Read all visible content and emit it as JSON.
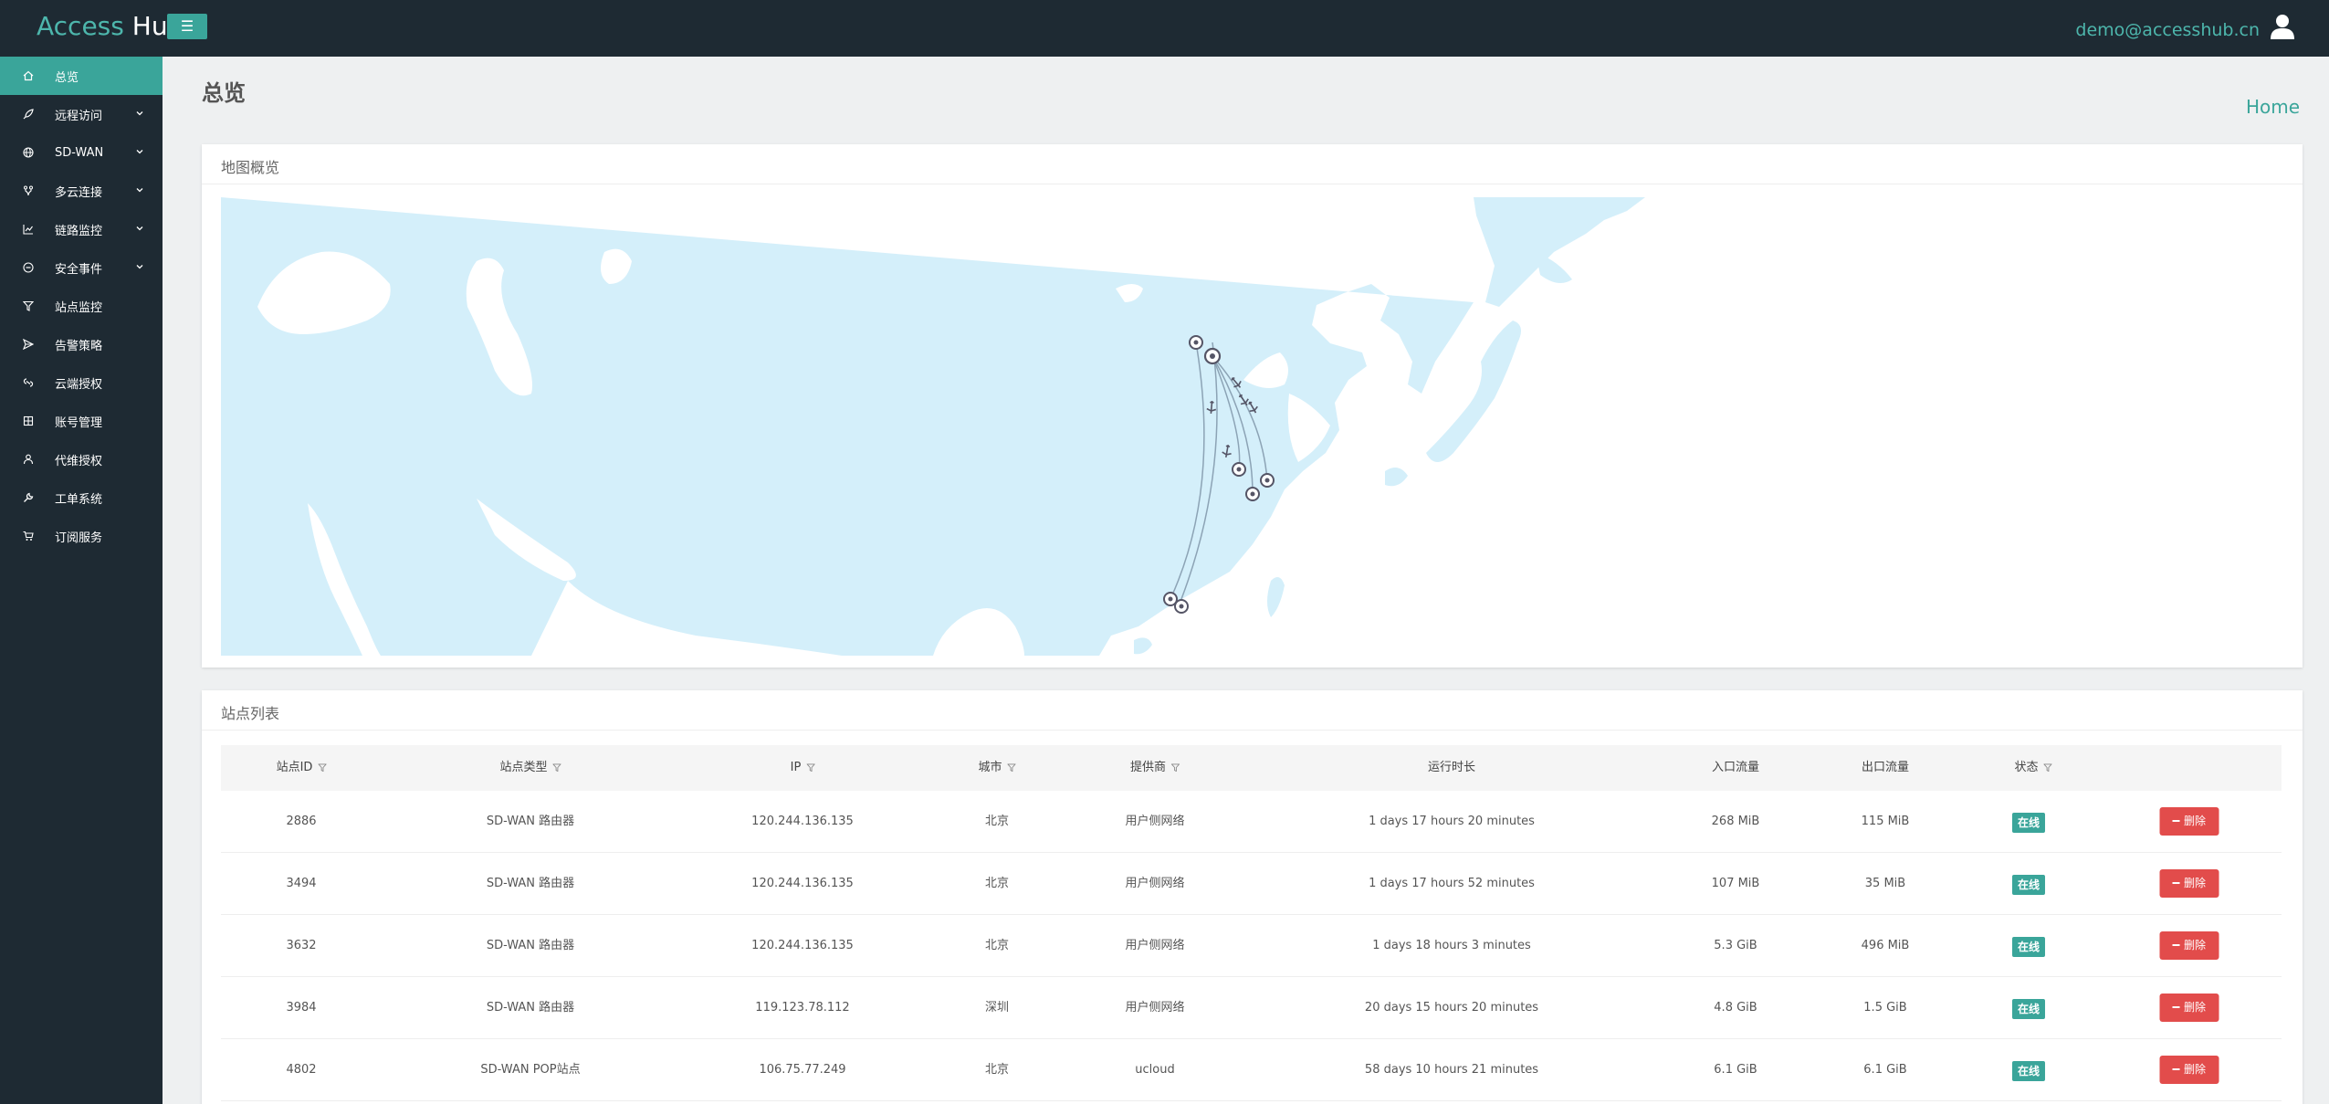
{
  "header": {
    "brand_part1": "Access",
    "brand_part2": "Hub",
    "menu_toggle": "☰",
    "user_email": "demo@accesshub.cn"
  },
  "sidebar": {
    "items": [
      {
        "label": "总览",
        "active": true
      },
      {
        "label": "远程访问",
        "chevron": true
      },
      {
        "label": "SD-WAN",
        "chevron": true
      },
      {
        "label": "多云连接",
        "chevron": true
      },
      {
        "label": "链路监控",
        "chevron": true
      },
      {
        "label": "安全事件",
        "chevron": true
      },
      {
        "label": "站点监控"
      },
      {
        "label": "告警策略"
      },
      {
        "label": "云端授权"
      },
      {
        "label": "账号管理"
      },
      {
        "label": "代维授权"
      },
      {
        "label": "工单系统"
      },
      {
        "label": "订阅服务"
      }
    ]
  },
  "page": {
    "title": "总览",
    "breadcrumb": "Home"
  },
  "map_card": {
    "title": "地图概览"
  },
  "table_card": {
    "title": "站点列表",
    "columns": [
      "站点ID",
      "站点类型",
      "IP",
      "城市",
      "提供商",
      "运行时长",
      "入口流量",
      "出口流量",
      "状态"
    ],
    "rows": [
      {
        "id": "2886",
        "type": "SD-WAN 路由器",
        "ip": "120.244.136.135",
        "city": "北京",
        "provider": "用户侧网络",
        "uptime": "1 days 17 hours 20 minutes",
        "in": "268 MiB",
        "out": "115 MiB",
        "status": "在线",
        "action": "删除"
      },
      {
        "id": "3494",
        "type": "SD-WAN 路由器",
        "ip": "120.244.136.135",
        "city": "北京",
        "provider": "用户侧网络",
        "uptime": "1 days 17 hours 52 minutes",
        "in": "107 MiB",
        "out": "35 MiB",
        "status": "在线",
        "action": "删除"
      },
      {
        "id": "3632",
        "type": "SD-WAN 路由器",
        "ip": "120.244.136.135",
        "city": "北京",
        "provider": "用户侧网络",
        "uptime": "1 days 18 hours 3 minutes",
        "in": "5.3 GiB",
        "out": "496 MiB",
        "status": "在线",
        "action": "删除"
      },
      {
        "id": "3984",
        "type": "SD-WAN 路由器",
        "ip": "119.123.78.112",
        "city": "深圳",
        "provider": "用户侧网络",
        "uptime": "20 days 15 hours 20 minutes",
        "in": "4.8 GiB",
        "out": "1.5 GiB",
        "status": "在线",
        "action": "删除"
      },
      {
        "id": "4802",
        "type": "SD-WAN POP站点",
        "ip": "106.75.77.249",
        "city": "北京",
        "provider": "ucloud",
        "uptime": "58 days 10 hours 21 minutes",
        "in": "6.1 GiB",
        "out": "6.1 GiB",
        "status": "在线",
        "action": "删除"
      }
    ]
  },
  "colors": {
    "header_bg": "#1e2a33",
    "accent": "#3aa59a",
    "danger": "#e24c4b",
    "map_land": "#d4effa"
  }
}
